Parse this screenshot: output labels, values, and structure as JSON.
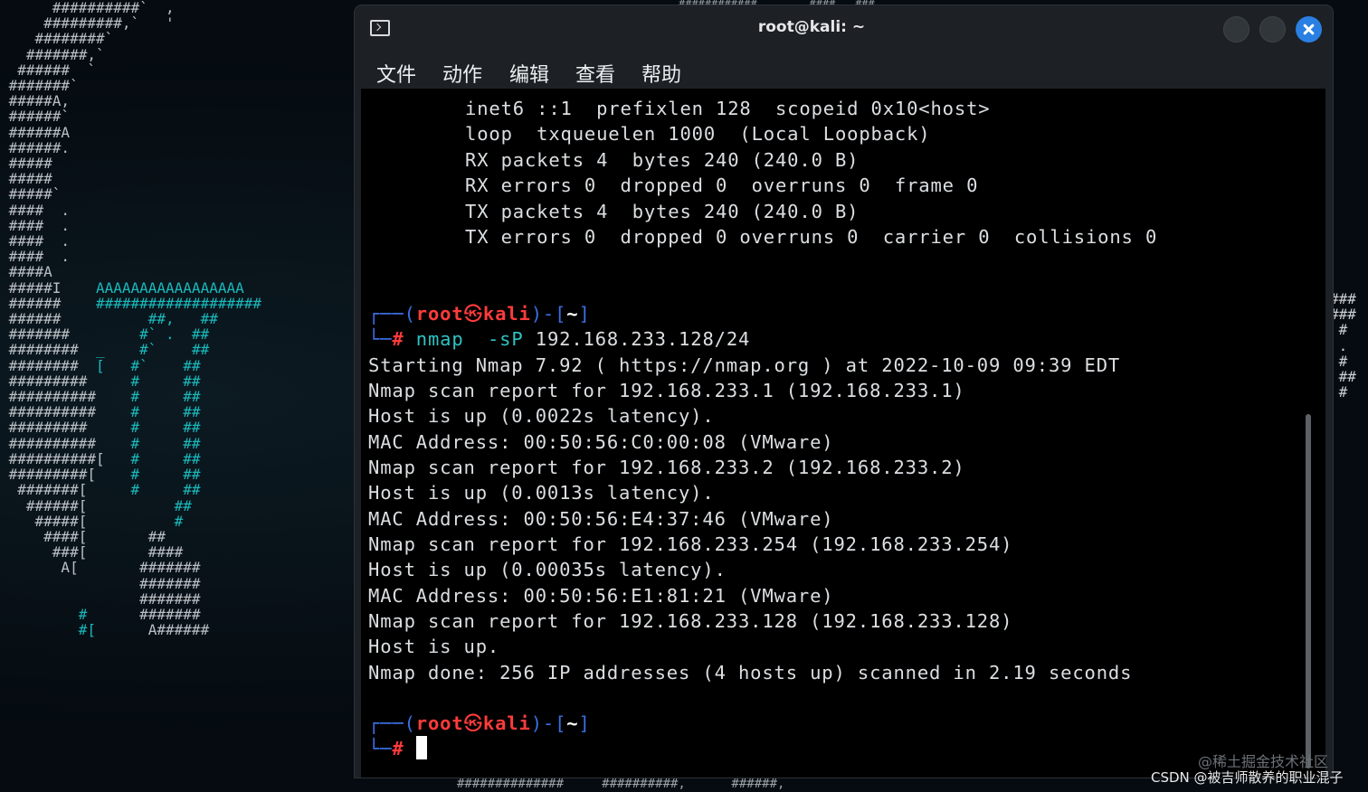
{
  "window": {
    "title": "root@kali: ~"
  },
  "menu": [
    "文件",
    "动作",
    "编辑",
    "查看",
    "帮助"
  ],
  "output_top": [
    "inet6 ::1  prefixlen 128  scopeid 0x10<host>",
    "loop  txqueuelen 1000  (Local Loopback)",
    "RX packets 4  bytes 240 (240.0 B)",
    "RX errors 0  dropped 0  overruns 0  frame 0",
    "TX packets 4  bytes 240 (240.0 B)",
    "TX errors 0  dropped 0 overruns 0  carrier 0  collisions 0"
  ],
  "prompt1": {
    "open": "┌──(",
    "user": "root",
    "icon": "㉿",
    "host": "kali",
    "close": ")-[",
    "dir": "~",
    "end": "]",
    "hash_prefix": "└─",
    "hash": "#",
    "cmd": "nmap",
    "flag": "-sP",
    "args": "192.168.233.128/24"
  },
  "nmap_output": [
    "Starting Nmap 7.92 ( https://nmap.org ) at 2022-10-09 09:39 EDT",
    "Nmap scan report for 192.168.233.1 (192.168.233.1)",
    "Host is up (0.0022s latency).",
    "MAC Address: 00:50:56:C0:00:08 (VMware)",
    "Nmap scan report for 192.168.233.2 (192.168.233.2)",
    "Host is up (0.0013s latency).",
    "MAC Address: 00:50:56:E4:37:46 (VMware)",
    "Nmap scan report for 192.168.233.254 (192.168.233.254)",
    "Host is up (0.00035s latency).",
    "MAC Address: 00:50:56:E1:81:21 (VMware)",
    "Nmap scan report for 192.168.233.128 (192.168.233.128)",
    "Host is up.",
    "Nmap done: 256 IP addresses (4 hosts up) scanned in 2.19 seconds"
  ],
  "prompt2": {
    "open": "┌──(",
    "user": "root",
    "icon": "㉿",
    "host": "kali",
    "close": ")-[",
    "dir": "~",
    "end": "]",
    "hash_prefix": "└─",
    "hash": "#"
  },
  "watermarks": {
    "line1": "@稀土掘金技术社区",
    "line2": "CSDN @被吉师散养的职业混子"
  },
  "colors": {
    "prompt_frame": "#3b6fe2",
    "prompt_user": "#ff3b3b",
    "command": "#2fc3c3",
    "close_button": "#2a7fe3"
  }
}
